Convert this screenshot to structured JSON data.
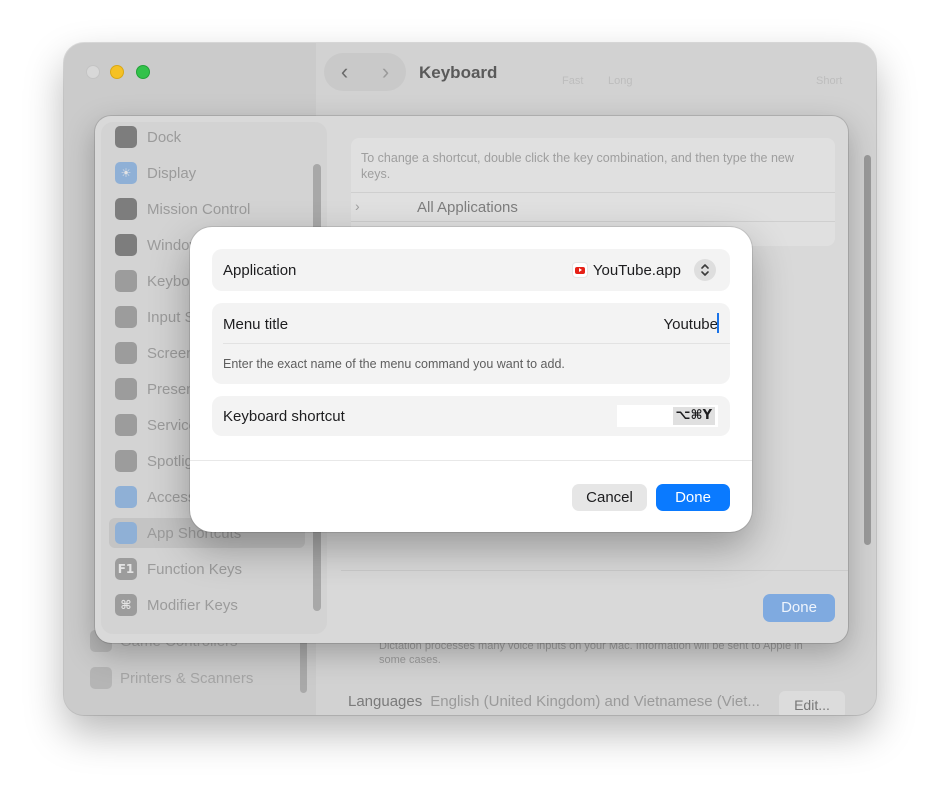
{
  "window": {
    "title": "Keyboard",
    "faint_labels": {
      "fast": "Fast",
      "long": "Long",
      "short": "Short"
    },
    "sidebar_items": [
      {
        "label": "Game Controllers",
        "icon": "gamepad-icon"
      },
      {
        "label": "Printers & Scanners",
        "icon": "printer-icon"
      }
    ],
    "dictation_note": "Dictation processes many voice inputs on your Mac. Information will be sent to Apple in some cases.",
    "languages_label": "Languages",
    "languages_value": "English (United Kingdom) and Vietnamese (Viet...",
    "edit_button": "Edit..."
  },
  "sheet": {
    "items": [
      {
        "label": "Dock",
        "icon": "dock-icon"
      },
      {
        "label": "Display",
        "icon": "display-brightness-icon"
      },
      {
        "label": "Mission Control",
        "icon": "mission-control-icon"
      },
      {
        "label": "Windows",
        "icon": "windows-icon"
      },
      {
        "label": "Keyboard",
        "icon": "keyboard-icon"
      },
      {
        "label": "Input Sources",
        "icon": "input-sources-icon"
      },
      {
        "label": "Screenshots",
        "icon": "screenshot-icon"
      },
      {
        "label": "Presenter Overlay",
        "icon": "presenter-overlay-icon"
      },
      {
        "label": "Services",
        "icon": "services-icon"
      },
      {
        "label": "Spotlight",
        "icon": "spotlight-icon"
      },
      {
        "label": "Accessibility",
        "icon": "accessibility-icon"
      },
      {
        "label": "App Shortcuts",
        "icon": "app-shortcuts-icon",
        "selected": true
      },
      {
        "label": "Function Keys",
        "icon": "function-keys-icon",
        "glyph": "F1"
      },
      {
        "label": "Modifier Keys",
        "icon": "modifier-keys-icon",
        "glyph": "⌘"
      }
    ],
    "hint": "To change a shortcut, double click the key combination, and then type the new keys.",
    "all_applications": "All Applications",
    "done_button": "Done"
  },
  "dialog": {
    "application_label": "Application",
    "application_value": "YouTube.app",
    "menu_title_label": "Menu title",
    "menu_title_value": "Youtube",
    "menu_title_hint": "Enter the exact name of the menu command you want to add.",
    "keyboard_shortcut_label": "Keyboard shortcut",
    "keyboard_shortcut_value": "⌥⌘Y",
    "cancel_button": "Cancel",
    "done_button": "Done"
  },
  "colors": {
    "accent": "#0a7aff",
    "youtube_red": "#e62117"
  }
}
